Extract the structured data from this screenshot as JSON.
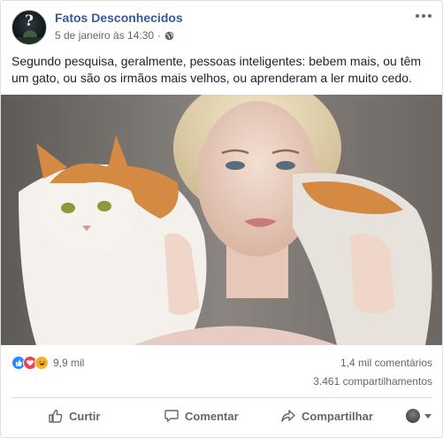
{
  "post": {
    "page_name": "Fatos Desconhecidos",
    "timestamp": "5 de janeiro às 14:30",
    "separator": "·",
    "text": "Segundo pesquisa, geralmente, pessoas inteligentes: bebem mais, ou têm um gato, ou são os irmãos mais velhos, ou aprenderam a ler muito cedo.",
    "icons": {
      "avatar_glyph": "?",
      "privacy": "globe-icon",
      "more": "more-icon"
    }
  },
  "stats": {
    "reactions": [
      "like-icon",
      "love-icon",
      "haha-icon"
    ],
    "reactions_count": "9,9 mil",
    "comments": "1,4 mil comentários",
    "shares": "3.461 compartilhamentos"
  },
  "actions": {
    "like": "Curtir",
    "comment": "Comentar",
    "share": "Compartilhar"
  },
  "colors": {
    "link": "#385898",
    "secondary_text": "#606770",
    "like": "#2d88ff",
    "love": "#f33e58",
    "haha": "#f7b125"
  }
}
